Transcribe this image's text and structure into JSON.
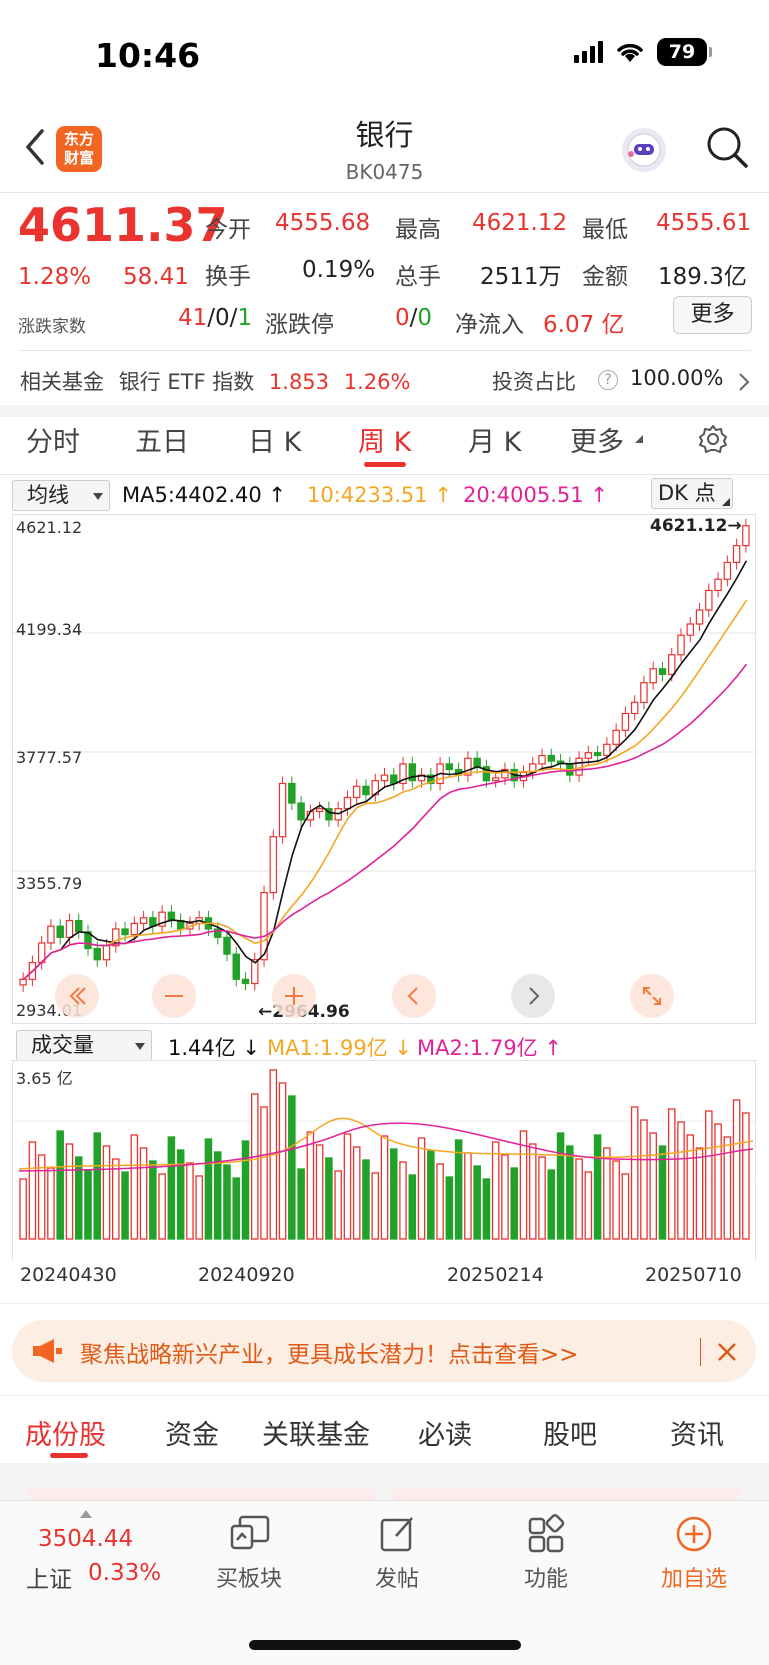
{
  "status": {
    "time": "10:46",
    "battery": "79"
  },
  "header": {
    "title": "银行",
    "code": "BK0475",
    "logo_text": "东方财富"
  },
  "quote": {
    "price": "4611.37",
    "change_pct": "1.28%",
    "change": "58.41",
    "open_label": "今开",
    "open": "4555.68",
    "high_label": "最高",
    "high": "4621.12",
    "low_label": "最低",
    "low": "4555.61",
    "turnover_label": "换手",
    "turnover": "0.19%",
    "volume_label": "总手",
    "volume": "2511万",
    "amount_label": "金额",
    "amount": "189.3亿",
    "breadth_label": "涨跌家数",
    "breadth_up": "41",
    "breadth_flat": "0",
    "breadth_down": "1",
    "limit_label": "涨跌停",
    "limit_up": "0",
    "limit_down": "0",
    "netflow_label": "净流入",
    "netflow": "6.07 亿",
    "more_label": "更多"
  },
  "fund": {
    "label": "相关基金",
    "name": "银行 ETF 指数",
    "price": "1.853",
    "pct": "1.26%",
    "ratio_label": "投资占比",
    "ratio": "100.00%"
  },
  "tabs": [
    {
      "label": "分时",
      "active": false
    },
    {
      "label": "五日",
      "active": false
    },
    {
      "label": "日 K",
      "active": false
    },
    {
      "label": "周 K",
      "active": true
    },
    {
      "label": "月 K",
      "active": false
    },
    {
      "label": "更多",
      "active": false
    }
  ],
  "ma_bar": {
    "selector": "均线",
    "ma5": "MA5:4402.40 ↑",
    "ma10": "10:4233.51 ↑",
    "ma20": "20:4005.51 ↑",
    "dk": "DK 点"
  },
  "colors": {
    "red": "#e8332f",
    "green": "#22a22a",
    "ma5": "#111111",
    "ma10": "#f5a623",
    "ma20": "#e0229b"
  },
  "chart": {
    "y_labels": [
      "4621.12",
      "4199.34",
      "3777.57",
      "3355.79",
      "2934.01"
    ],
    "max_marker": "4621.12→",
    "min_marker": "←2964.96"
  },
  "volume": {
    "selector": "成交量",
    "vol": "1.44亿 ↓",
    "ma1": "MA1:1.99亿 ↓",
    "ma2": "MA2:1.79亿 ↑",
    "y_max": "3.65 亿",
    "dates": [
      "20240430",
      "20240920",
      "20250214",
      "20250710"
    ]
  },
  "banner": {
    "text": "聚焦战略新兴产业，更具成长潜力！点击查看>>"
  },
  "sub_tabs": [
    {
      "label": "成份股",
      "active": true
    },
    {
      "label": "资金",
      "active": false
    },
    {
      "label": "关联基金",
      "active": false
    },
    {
      "label": "必读",
      "active": false
    },
    {
      "label": "股吧",
      "active": false
    },
    {
      "label": "资讯",
      "active": false
    }
  ],
  "bottom": {
    "index_value": "3504.44",
    "index_name": "上证",
    "index_pct": "0.33%",
    "buy_label": "买板块",
    "post_label": "发帖",
    "func_label": "功能",
    "add_label": "加自选"
  }
}
